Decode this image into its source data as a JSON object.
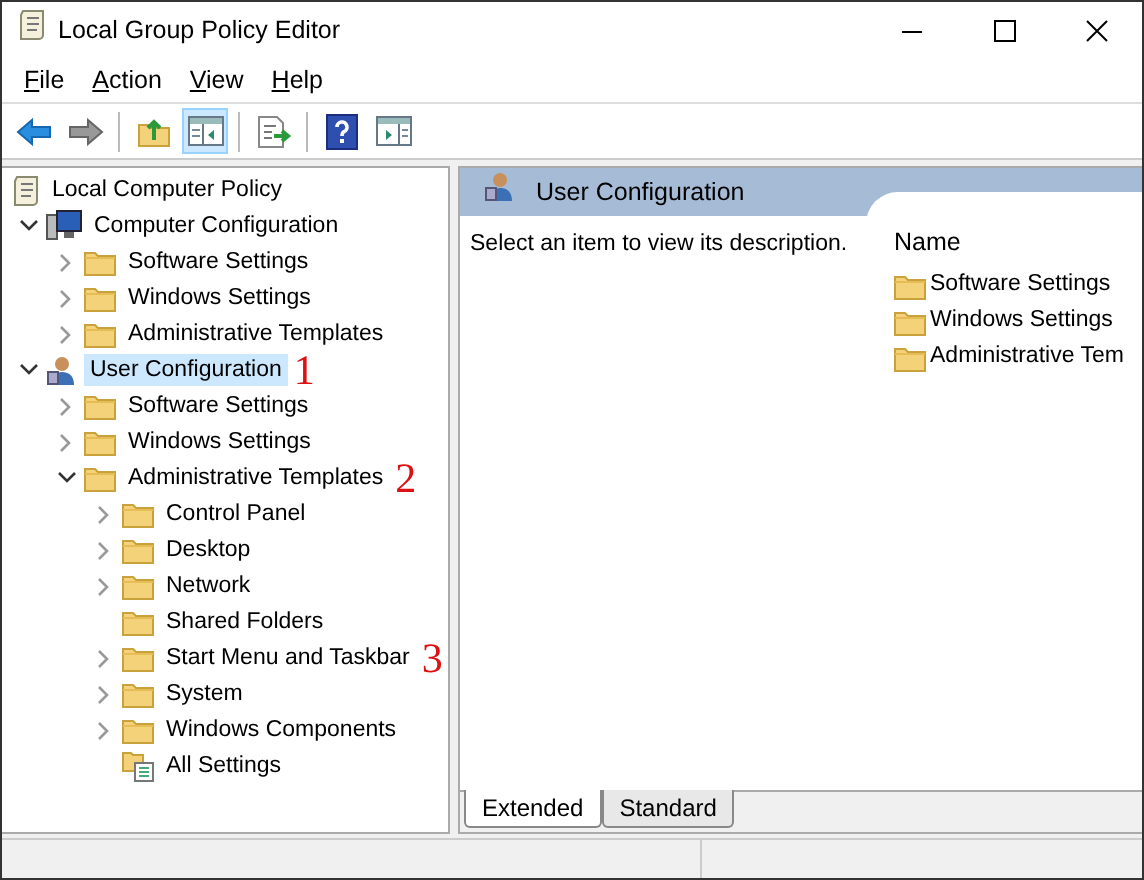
{
  "window": {
    "title": "Local Group Policy Editor"
  },
  "menu": [
    "File",
    "Action",
    "View",
    "Help"
  ],
  "toolbar": [
    [
      {
        "kind": "back",
        "pressed": false
      },
      {
        "kind": "forward",
        "pressed": false
      }
    ],
    [
      {
        "kind": "up",
        "pressed": false
      },
      {
        "kind": "tree",
        "pressed": true
      }
    ],
    [
      {
        "kind": "export",
        "pressed": false
      }
    ],
    [
      {
        "kind": "help",
        "pressed": false
      },
      {
        "kind": "pane",
        "pressed": false
      }
    ]
  ],
  "tree": {
    "label": "Local Computer Policy",
    "kind": "policy",
    "selected": false,
    "children": [
      {
        "label": "Computer Configuration",
        "kind": "computer",
        "selected": false,
        "expanded": true,
        "children": [
          {
            "label": "Software Settings",
            "kind": "folder",
            "selected": false,
            "expanded": false
          },
          {
            "label": "Windows Settings",
            "kind": "folder",
            "selected": false,
            "expanded": false
          },
          {
            "label": "Administrative Templates",
            "kind": "folder",
            "selected": false,
            "expanded": false
          }
        ]
      },
      {
        "label": "User Configuration",
        "kind": "user",
        "selected": true,
        "expanded": true,
        "annotation": "1",
        "children": [
          {
            "label": "Software Settings",
            "kind": "folder",
            "selected": false,
            "expanded": false
          },
          {
            "label": "Windows Settings",
            "kind": "folder",
            "selected": false,
            "expanded": false
          },
          {
            "label": "Administrative Templates",
            "kind": "folder",
            "selected": false,
            "expanded": true,
            "annotation": "2",
            "children": [
              {
                "label": "Control Panel",
                "kind": "folder",
                "selected": false,
                "expanded": false
              },
              {
                "label": "Desktop",
                "kind": "folder",
                "selected": false,
                "expanded": false
              },
              {
                "label": "Network",
                "kind": "folder",
                "selected": false,
                "expanded": false
              },
              {
                "label": "Shared Folders",
                "kind": "folder",
                "selected": false
              },
              {
                "label": "Start Menu and Taskbar",
                "kind": "folder",
                "selected": false,
                "expanded": false,
                "annotation": "3"
              },
              {
                "label": "System",
                "kind": "folder",
                "selected": false,
                "expanded": false
              },
              {
                "label": "Windows Components",
                "kind": "folder",
                "selected": false,
                "expanded": false
              },
              {
                "label": "All Settings",
                "kind": "settings",
                "selected": false
              }
            ]
          }
        ]
      }
    ]
  },
  "details": {
    "header": {
      "kind": "user",
      "title": "User Configuration"
    },
    "description": "Select an item to view its description.",
    "column": "Name",
    "items": [
      {
        "label": "Software Settings",
        "kind": "folder"
      },
      {
        "label": "Windows Settings",
        "kind": "folder"
      },
      {
        "label": "Administrative Tem",
        "kind": "folder"
      }
    ]
  },
  "tabs": [
    {
      "label": "Extended",
      "selected": true
    },
    {
      "label": "Standard",
      "selected": false
    }
  ]
}
